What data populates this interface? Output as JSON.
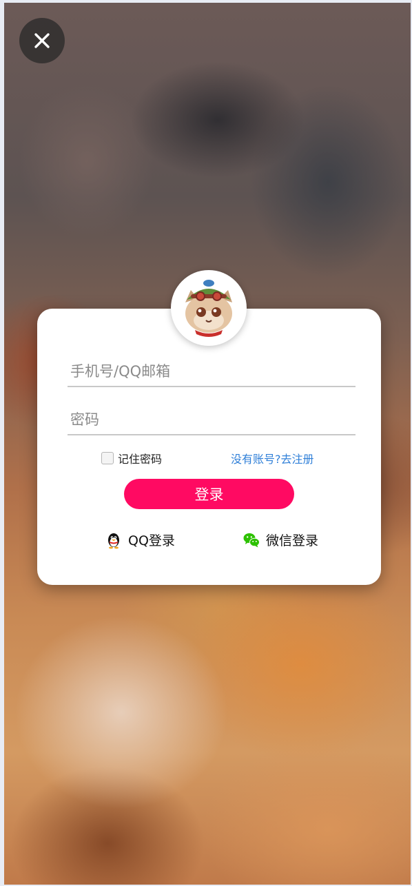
{
  "close": {
    "icon": "close-icon"
  },
  "avatar": {
    "icon": "cartoon-avatar"
  },
  "form": {
    "username_placeholder": "手机号/QQ邮箱",
    "password_placeholder": "密码",
    "remember_label": "记住密码",
    "register_link": "没有账号?去注册",
    "login_button": "登录"
  },
  "social": {
    "qq_label": "QQ登录",
    "wechat_label": "微信登录"
  },
  "colors": {
    "login_button": "#ff0a62",
    "register_link": "#2f7fd8",
    "wechat_green": "#2dc100"
  }
}
